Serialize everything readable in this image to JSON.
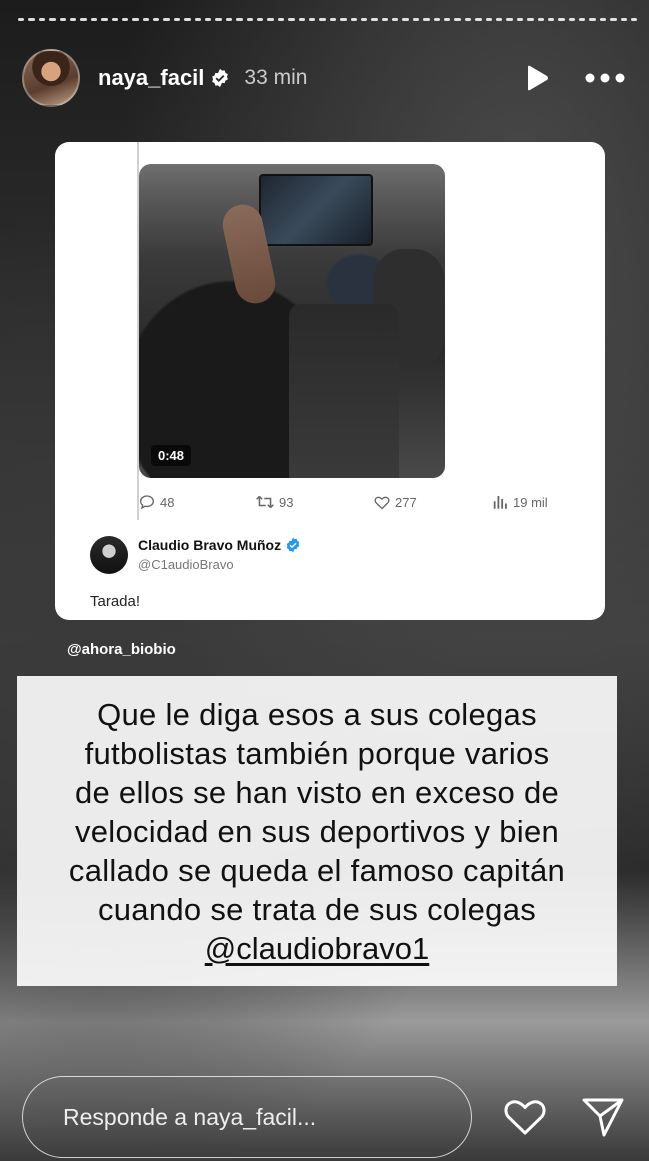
{
  "story": {
    "progress_segments": 60,
    "username": "naya_facil",
    "time_ago": "33 min",
    "source_tag": "@ahora_biobio"
  },
  "tweet": {
    "video_duration": "0:48",
    "stats": {
      "replies": "48",
      "reposts": "93",
      "likes": "277",
      "views": "19 mil"
    },
    "reply": {
      "author_name": "Claudio Bravo Muñoz",
      "author_handle": "@C1audioBravo",
      "text": "Tarada!"
    }
  },
  "caption": {
    "lines": [
      "Que le diga esos a sus colegas",
      "futbolistas también  porque varios",
      "de ellos se han visto en exceso de",
      "velocidad en sus deportivos y bien",
      "callado se queda el famoso capitán",
      "cuando se trata de sus colegas"
    ],
    "mention": "@claudiobravo1"
  },
  "reply_bar": {
    "placeholder": "Responde a naya_facil..."
  },
  "colors": {
    "accent_verified_blue": "#1d9bf0",
    "text_white": "#ffffff"
  }
}
